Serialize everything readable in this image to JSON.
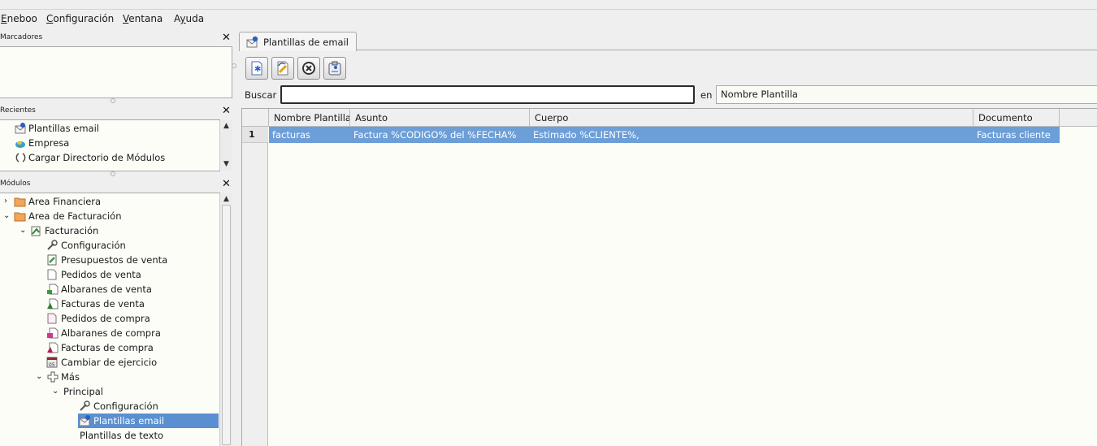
{
  "menu": {
    "items": [
      {
        "label": "Eneboo",
        "key": "E"
      },
      {
        "label": "Configuración",
        "key": "C"
      },
      {
        "label": "Ventana",
        "key": "V"
      },
      {
        "label": "Ayuda",
        "key": "y"
      }
    ]
  },
  "docks": {
    "marcadores": {
      "title": "Marcadores"
    },
    "recientes": {
      "title": "Recientes",
      "items": [
        {
          "label": "Plantillas email",
          "icon": "email-template-icon"
        },
        {
          "label": "Empresa",
          "icon": "company-icon"
        },
        {
          "label": "Cargar Directorio de Módulos",
          "icon": "load-directory-icon"
        }
      ]
    },
    "modulos": {
      "title": "Módulos",
      "tree": [
        {
          "label": "Area Financiera",
          "level": 0,
          "expander": "collapsed",
          "icon": "folder-icon"
        },
        {
          "label": "Area de Facturación",
          "level": 0,
          "expander": "expanded",
          "icon": "folder-icon"
        },
        {
          "label": "Facturación",
          "level": 1,
          "expander": "expanded",
          "icon": "invoicing-module-icon"
        },
        {
          "label": "Configuración",
          "level": 2,
          "icon": "wrench-icon"
        },
        {
          "label": "Presupuestos de venta",
          "level": 2,
          "icon": "sales-quote-icon"
        },
        {
          "label": "Pedidos de venta",
          "level": 2,
          "icon": "sales-order-icon"
        },
        {
          "label": "Albaranes de venta",
          "level": 2,
          "icon": "sales-delivery-note-icon"
        },
        {
          "label": "Facturas de venta",
          "level": 2,
          "icon": "sales-invoice-icon"
        },
        {
          "label": "Pedidos de compra",
          "level": 2,
          "icon": "purchase-order-icon"
        },
        {
          "label": "Albaranes de compra",
          "level": 2,
          "icon": "purchase-delivery-note-icon"
        },
        {
          "label": "Facturas de compra",
          "level": 2,
          "icon": "purchase-invoice-icon"
        },
        {
          "label": "Cambiar de ejercicio",
          "level": 2,
          "icon": "fiscal-year-icon"
        },
        {
          "label": "Más",
          "level": 2,
          "expander": "expanded",
          "icon": "plus-icon"
        },
        {
          "label": "Principal",
          "level": 3,
          "expander": "expanded"
        },
        {
          "label": "Configuración",
          "level": 4,
          "icon": "wrench-icon"
        },
        {
          "label": "Plantillas email",
          "level": 4,
          "icon": "email-template-icon",
          "selected": true
        },
        {
          "label": "Plantillas de texto",
          "level": 4
        }
      ]
    }
  },
  "main": {
    "tab": {
      "label": "Plantillas de email",
      "icon": "email-template-icon"
    },
    "toolbar": [
      {
        "name": "new-record-button",
        "icon": "new-record-icon"
      },
      {
        "name": "edit-record-button",
        "icon": "edit-record-icon"
      },
      {
        "name": "delete-record-button",
        "icon": "delete-record-icon"
      },
      {
        "name": "view-record-button",
        "icon": "view-record-icon"
      }
    ],
    "search": {
      "label": "Buscar",
      "value": "",
      "in_label": "en",
      "field": "Nombre Plantilla"
    },
    "table": {
      "columns": [
        "Nombre Plantilla",
        "Asunto",
        "Cuerpo",
        "Documento"
      ],
      "rows": [
        {
          "num": "1",
          "cells": [
            "facturas",
            "Factura %CODIGO% del %FECHA%",
            "Estimado %CLIENTE%,",
            "Facturas cliente"
          ],
          "selected": true
        }
      ]
    }
  },
  "colors": {
    "selection": "#5a8fd0",
    "row_selection": "#6c9ed8",
    "background": "#efefef",
    "panel_bg": "#fdfdf8"
  }
}
